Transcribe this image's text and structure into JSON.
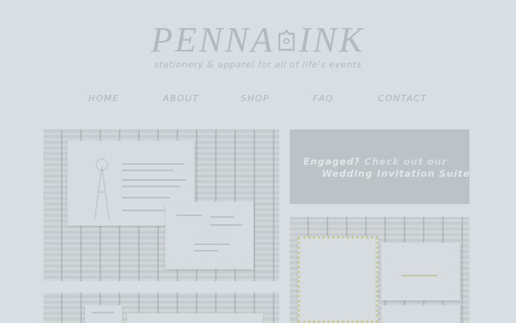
{
  "logo": {
    "left": "PENNA",
    "right": "INK",
    "tagline": "stationery & apparel for all of life's events",
    "color": "#b3b9bd"
  },
  "nav": {
    "items": [
      {
        "label": "HOME"
      },
      {
        "label": "ABOUT"
      },
      {
        "label": "SHOP"
      },
      {
        "label": "FAQ"
      },
      {
        "label": "CONTACT"
      }
    ]
  },
  "promo": {
    "line1_strong": "Engaged?",
    "line1_rest": "Check out our",
    "line2": "Wedding Invitation Suites!"
  },
  "colors": {
    "background": "#d8dee1",
    "promo_box": "#bcc3c6",
    "wood": "#c9cfd2"
  }
}
